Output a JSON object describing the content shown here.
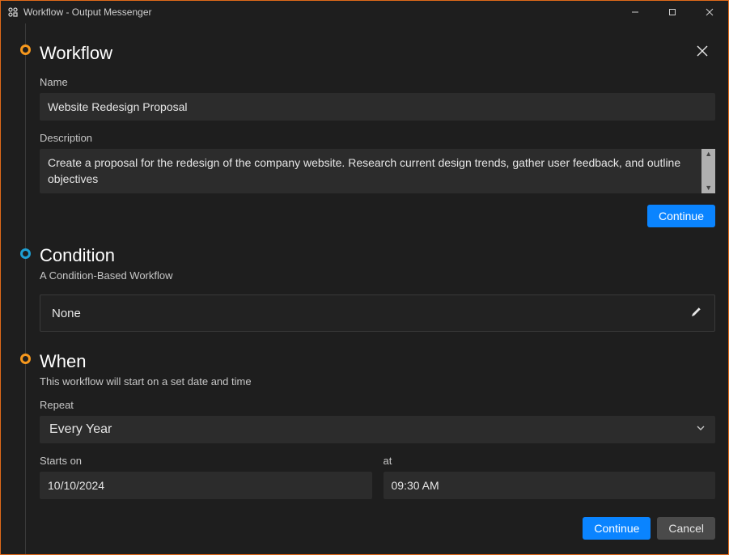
{
  "titlebar": {
    "title": "Workflow - Output Messenger"
  },
  "workflow": {
    "heading": "Workflow",
    "name_label": "Name",
    "name_value": "Website Redesign Proposal",
    "description_label": "Description",
    "description_value": "Create a proposal for the redesign of the company website. Research current design trends, gather user feedback, and outline objectives",
    "continue_label": "Continue"
  },
  "condition": {
    "heading": "Condition",
    "sub": "A Condition-Based Workflow",
    "value": "None"
  },
  "when": {
    "heading": "When",
    "sub": "This workflow will start on a set date and time",
    "repeat_label": "Repeat",
    "repeat_value": "Every Year",
    "starts_label": "Starts on",
    "starts_value": "10/10/2024",
    "at_label": "at",
    "at_value": "09:30 AM",
    "continue_label": "Continue",
    "cancel_label": "Cancel"
  }
}
